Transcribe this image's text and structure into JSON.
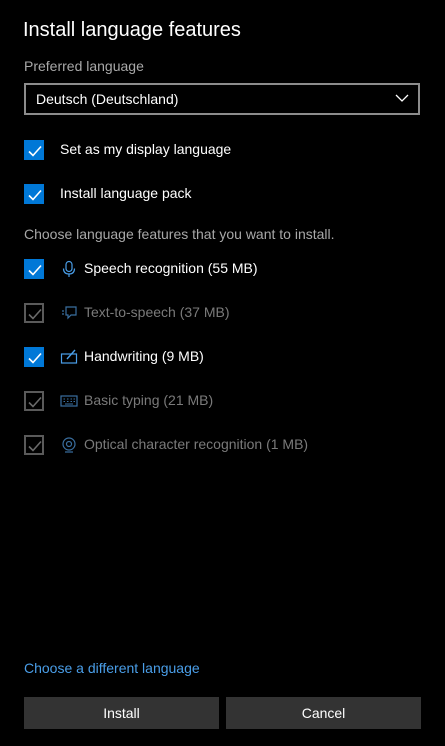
{
  "dialog": {
    "title": "Install language features",
    "preferred_label": "Preferred language",
    "preferred_value": "Deutsch (Deutschland)",
    "option_display": "Set as my display language",
    "option_pack": "Install language pack",
    "features_hint": "Choose language features that you want to install.",
    "features": [
      {
        "label": "Speech recognition (55 MB)",
        "checked": true,
        "enabled": true,
        "icon": "microphone-icon"
      },
      {
        "label": "Text-to-speech (37 MB)",
        "checked": true,
        "enabled": false,
        "icon": "speech-bubble-icon"
      },
      {
        "label": "Handwriting (9 MB)",
        "checked": true,
        "enabled": true,
        "icon": "pen-icon"
      },
      {
        "label": "Basic typing (21 MB)",
        "checked": true,
        "enabled": false,
        "icon": "keyboard-icon"
      },
      {
        "label": "Optical character recognition (1 MB)",
        "checked": true,
        "enabled": false,
        "icon": "eye-icon"
      }
    ],
    "change_link": "Choose a different language",
    "install_label": "Install",
    "cancel_label": "Cancel"
  },
  "colors": {
    "accent": "#0078d7",
    "link": "#4a9ee8",
    "background": "#000000",
    "button": "#333333",
    "disabled_text": "#7a7a7a"
  }
}
